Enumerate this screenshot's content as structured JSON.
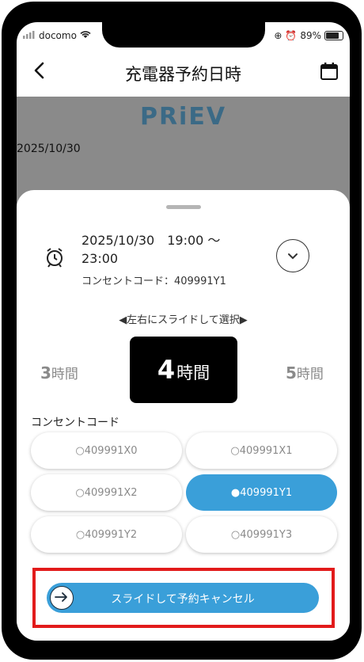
{
  "status_bar": {
    "carrier": "docomo",
    "battery": "89%"
  },
  "header": {
    "title": "充電器予約日時"
  },
  "background": {
    "brand": "PRiEV",
    "date": "2025/10/30"
  },
  "reservation": {
    "datetime_line1": "2025/10/30　19:00 〜",
    "datetime_line2": "23:00",
    "code_line": "コンセントコード：409991Y1"
  },
  "duration": {
    "hint": "◀左右にスライドして選択▶",
    "prev": {
      "num": "3",
      "unit": "時間"
    },
    "selected": {
      "num": "4",
      "unit": "時間"
    },
    "next": {
      "num": "5",
      "unit": "時間"
    }
  },
  "outlets": {
    "label": "コンセントコード",
    "options": [
      "○409991X0",
      "○409991X1",
      "○409991X2",
      "●409991Y1",
      "○409991Y2",
      "○409991Y3"
    ],
    "selected": "409991Y1"
  },
  "cancel_slider": {
    "label": "スライドして予約キャンセル"
  },
  "colors": {
    "accent": "#3a9fd9",
    "highlight_border": "#e21b1b",
    "brand": "#3b6a86"
  }
}
